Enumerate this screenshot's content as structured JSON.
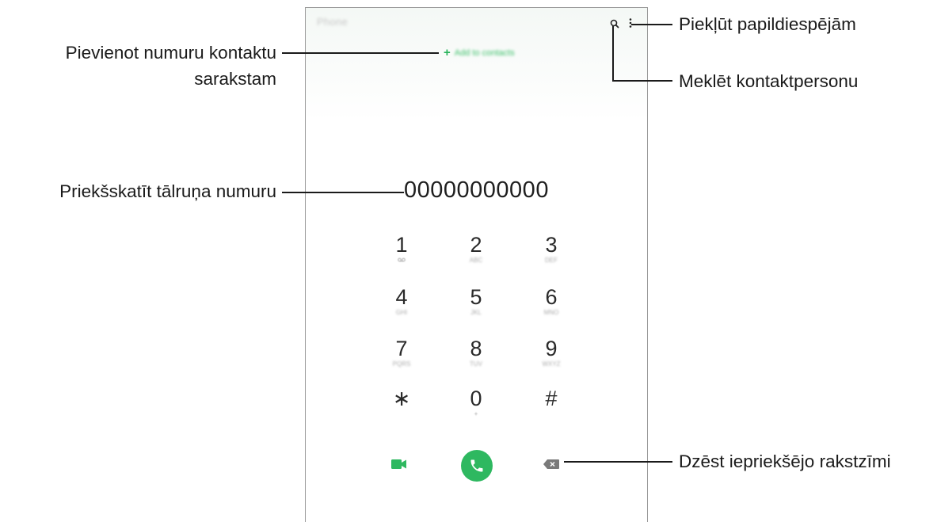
{
  "app": {
    "title": "Phone",
    "add_contact_label": "Add to contacts"
  },
  "preview_number": "00000000000",
  "keypad": [
    {
      "digit": "1",
      "sub": "oo"
    },
    {
      "digit": "2",
      "sub": "ABC"
    },
    {
      "digit": "3",
      "sub": "DEF"
    },
    {
      "digit": "4",
      "sub": "GHI"
    },
    {
      "digit": "5",
      "sub": "JKL"
    },
    {
      "digit": "6",
      "sub": "MNO"
    },
    {
      "digit": "7",
      "sub": "PQRS"
    },
    {
      "digit": "8",
      "sub": "TUV"
    },
    {
      "digit": "9",
      "sub": "WXYZ"
    },
    {
      "digit": "∗",
      "sub": ""
    },
    {
      "digit": "0",
      "sub": "+"
    },
    {
      "digit": "#",
      "sub": ""
    }
  ],
  "icons": {
    "search": "search-icon",
    "more": "more-options-icon",
    "add": "plus-icon",
    "video_call": "video-call-icon",
    "voice_call": "phone-icon",
    "backspace": "backspace-icon"
  },
  "colors": {
    "accent": "#2eb860",
    "frame": "#9a9a9a",
    "backspace": "#7a7a7a"
  },
  "callouts": {
    "more_options": "Piekļūt papildiespējām",
    "search_contact": "Meklēt kontaktpersonu",
    "add_number_line1": "Pievienot numuru kontaktu",
    "add_number_line2": "sarakstam",
    "preview_number": "Priekšskatīt tālruņa numuru",
    "delete_char": "Dzēst iepriekšējo rakstzīmi"
  }
}
